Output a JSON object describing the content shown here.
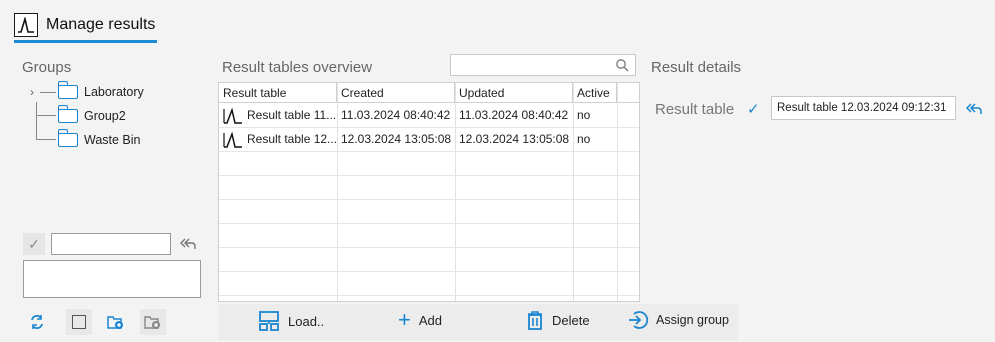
{
  "header": {
    "tab_label": "Manage results"
  },
  "groups": {
    "title": "Groups",
    "items": [
      {
        "label": "Laboratory"
      },
      {
        "label": "Group2"
      },
      {
        "label": "Waste Bin"
      }
    ],
    "name_input_value": "",
    "description_value": ""
  },
  "overview": {
    "title": "Result tables overview",
    "search_placeholder": "",
    "columns": [
      "Result table",
      "Created",
      "Updated",
      "Active"
    ],
    "rows": [
      {
        "name": "Result table 11....",
        "created": "11.03.2024 08:40:42",
        "updated": "11.03.2024 08:40:42",
        "active": "no"
      },
      {
        "name": "Result table 12....",
        "created": "12.03.2024 13:05:08",
        "updated": "12.03.2024 13:05:08",
        "active": "no"
      }
    ],
    "actions": {
      "load": "Load..",
      "add": "Add",
      "delete": "Delete",
      "assign": "Assign group"
    }
  },
  "details": {
    "title": "Result details",
    "field_label": "Result table",
    "field_value": "Result table 12.03.2024 09:12:31"
  },
  "colors": {
    "accent": "#1e8ad6",
    "icon_blue": "#1a86d0"
  }
}
